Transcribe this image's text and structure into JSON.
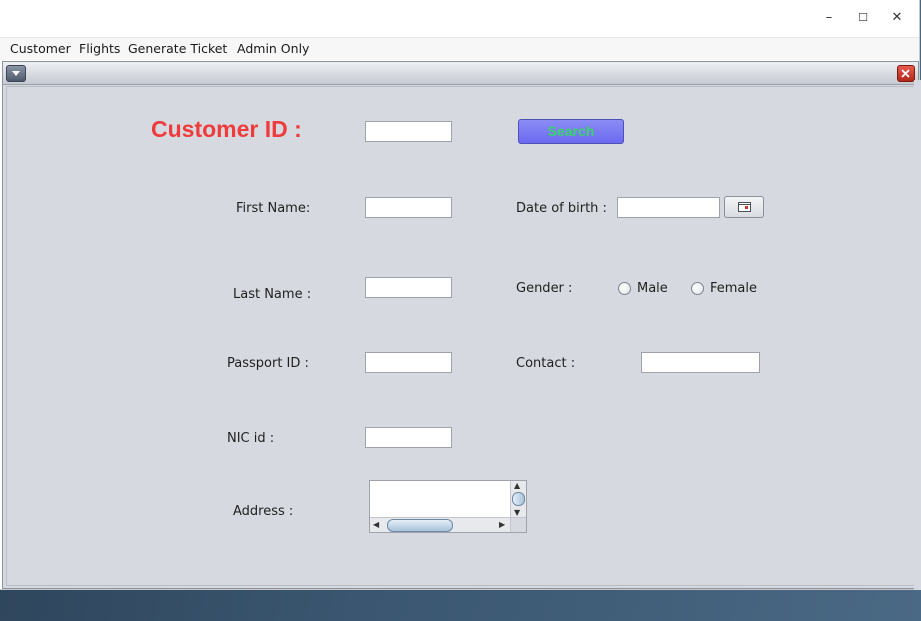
{
  "window": {
    "controls": {
      "minimize": "–",
      "maximize": "☐",
      "close": "✕"
    }
  },
  "menubar": {
    "items": [
      "Customer",
      "Flights",
      "Generate Ticket",
      "Admin Only"
    ]
  },
  "form": {
    "customer_id_label": "Customer ID :",
    "search_label": "Search",
    "first_name_label": "First Name:",
    "last_name_label": "Last Name :",
    "passport_label": "Passport ID :",
    "nic_label": "NIC id  :",
    "address_label": "Address :",
    "dob_label": "Date of birth :",
    "gender_label": "Gender :",
    "gender_options": [
      "Male",
      "Female"
    ],
    "contact_label": "Contact :",
    "values": {
      "customer_id": "",
      "first_name": "",
      "last_name": "",
      "passport_id": "",
      "nic_id": "",
      "address": "",
      "dob": "",
      "contact": ""
    }
  },
  "icons": {
    "system_menu": "chevron-down-icon",
    "frame_close": "close-icon",
    "calendar": "calendar-icon"
  },
  "colors": {
    "customer_id_label": "#ef3b3b",
    "search_button_bg": "#7b7bf3",
    "search_button_text": "#39d46a",
    "frame_close": "#cc3a2f"
  }
}
